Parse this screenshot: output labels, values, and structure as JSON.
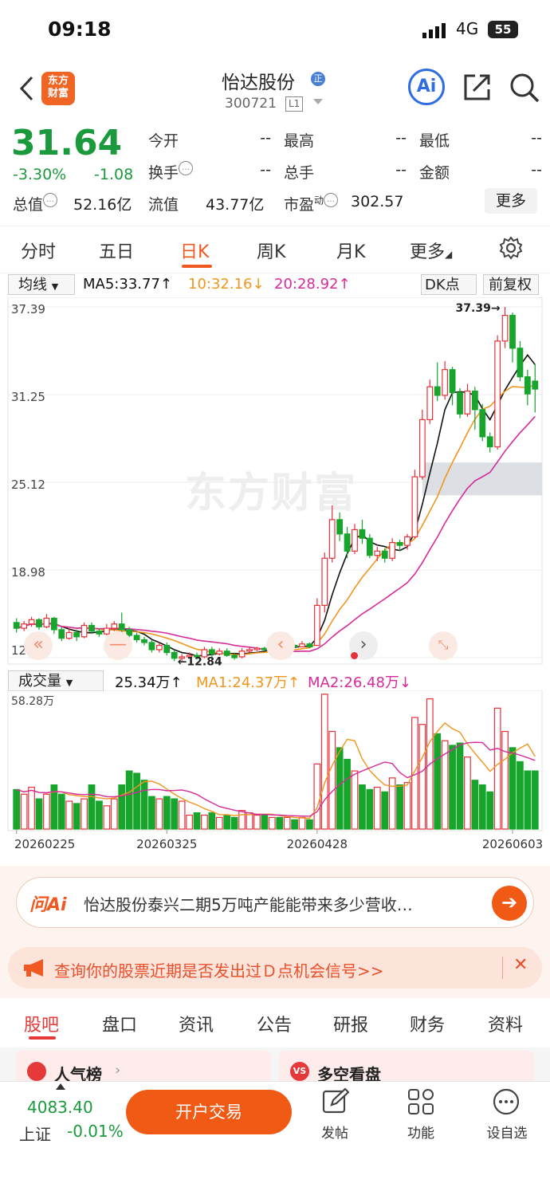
{
  "status_bar": {
    "time": "09:18",
    "network": "4G",
    "battery": "55"
  },
  "header": {
    "logo_line1": "东方",
    "logo_line2": "财富",
    "stock_name": "怡达股份",
    "badge": "正",
    "stock_code": "300721",
    "level": "L1",
    "ai_label": "Ai"
  },
  "quote": {
    "price": "31.64",
    "change_pct": "-3.30%",
    "change": "-1.08",
    "fields": [
      {
        "label": "今开",
        "value": "--"
      },
      {
        "label": "最高",
        "value": "--"
      },
      {
        "label": "最低",
        "value": "--"
      },
      {
        "label": "换手",
        "value": "--"
      },
      {
        "label": "总手",
        "value": "--"
      },
      {
        "label": "金额",
        "value": "--"
      }
    ],
    "total_mv_label": "总值",
    "total_mv": "52.16亿",
    "float_mv_label": "流值",
    "float_mv": "43.77亿",
    "pe_label": "市盈",
    "pe_sup": "动",
    "pe": "302.57",
    "more": "更多"
  },
  "tabs": [
    "分时",
    "五日",
    "日K",
    "周K",
    "月K",
    "更多"
  ],
  "active_tab": "日K",
  "chart_bar": {
    "selector": "均线",
    "ma5": "MA5:33.77↑",
    "ma10": "10:32.16↓",
    "ma20": "20:28.92↑",
    "dk": "DK点",
    "fq": "前复权"
  },
  "watermark": "东方财富",
  "colors": {
    "up": "#e8303a",
    "down": "#17a52c",
    "ma5": "#111111",
    "ma10": "#f0961e",
    "ma20": "#d62b9a",
    "accent": "#f05a22"
  },
  "chart_data": [
    {
      "type": "candlestick",
      "y_ticks": [
        "37.39",
        "31.25",
        "25.12",
        "18.98",
        "12.84"
      ],
      "ylim": [
        12.84,
        37.39
      ],
      "max_label": "37.39→",
      "min_label": "←12.84",
      "candles": [
        [
          15.3,
          14.9,
          15.6,
          14.6
        ],
        [
          14.9,
          15.2,
          15.4,
          14.7
        ],
        [
          15.2,
          15.5,
          15.7,
          15.0
        ],
        [
          15.5,
          15.0,
          15.6,
          14.8
        ],
        [
          15.0,
          15.6,
          15.9,
          14.9
        ],
        [
          15.6,
          14.8,
          15.7,
          14.5
        ],
        [
          14.8,
          14.2,
          15.0,
          14.0
        ],
        [
          14.2,
          14.6,
          14.9,
          14.1
        ],
        [
          14.6,
          14.3,
          14.8,
          14.0
        ],
        [
          14.3,
          15.1,
          15.3,
          14.2
        ],
        [
          15.1,
          14.7,
          15.3,
          14.5
        ],
        [
          14.7,
          14.5,
          14.9,
          14.3
        ],
        [
          14.5,
          14.9,
          15.2,
          14.4
        ],
        [
          14.9,
          15.2,
          15.4,
          14.7
        ],
        [
          15.2,
          14.8,
          16.0,
          14.6
        ],
        [
          14.8,
          14.4,
          15.0,
          14.2
        ],
        [
          14.4,
          14.1,
          14.6,
          13.9
        ],
        [
          14.1,
          13.9,
          14.3,
          13.7
        ],
        [
          13.9,
          13.4,
          14.1,
          13.2
        ],
        [
          13.4,
          13.7,
          13.9,
          13.2
        ],
        [
          13.7,
          13.2,
          13.9,
          13.0
        ],
        [
          13.2,
          12.8,
          13.4,
          12.6
        ],
        [
          12.8,
          12.9,
          13.1,
          12.6
        ],
        [
          12.9,
          13.0,
          13.2,
          12.8
        ],
        [
          13.0,
          12.9,
          13.2,
          12.7
        ],
        [
          12.9,
          13.4,
          13.6,
          12.8
        ],
        [
          13.4,
          13.1,
          13.6,
          12.9
        ],
        [
          13.1,
          13.3,
          13.5,
          13.0
        ],
        [
          13.3,
          13.0,
          13.5,
          12.9
        ],
        [
          13.0,
          12.84,
          13.2,
          12.7
        ],
        [
          12.9,
          13.3,
          13.5,
          12.8
        ],
        [
          13.3,
          13.4,
          13.6,
          13.2
        ],
        [
          13.4,
          13.5,
          13.6,
          13.3
        ],
        [
          13.5,
          13.4,
          13.6,
          13.3
        ],
        [
          13.4,
          13.6,
          13.7,
          13.3
        ],
        [
          13.6,
          13.5,
          13.8,
          13.4
        ],
        [
          13.5,
          13.7,
          13.9,
          13.5
        ],
        [
          13.7,
          13.6,
          13.8,
          13.5
        ],
        [
          13.6,
          13.8,
          14.0,
          13.6
        ],
        [
          13.8,
          13.6,
          13.9,
          13.5
        ],
        [
          13.7,
          16.5,
          17.0,
          13.7
        ],
        [
          16.5,
          19.8,
          20.2,
          16.0
        ],
        [
          19.8,
          22.5,
          23.5,
          19.5
        ],
        [
          22.5,
          21.5,
          23.0,
          21.0
        ],
        [
          21.5,
          20.3,
          22.0,
          19.8
        ],
        [
          20.3,
          21.8,
          22.2,
          20.1
        ],
        [
          21.8,
          21.2,
          22.5,
          20.8
        ],
        [
          21.2,
          20.0,
          21.5,
          19.8
        ],
        [
          20.0,
          20.3,
          20.6,
          19.6
        ],
        [
          20.3,
          19.8,
          20.5,
          19.5
        ],
        [
          19.8,
          20.9,
          21.2,
          19.6
        ],
        [
          20.9,
          20.7,
          21.1,
          20.3
        ],
        [
          20.7,
          21.3,
          21.5,
          20.4
        ],
        [
          21.3,
          25.5,
          26.0,
          21.2
        ],
        [
          25.5,
          29.5,
          30.2,
          25.3
        ],
        [
          29.5,
          31.8,
          32.3,
          29.2
        ],
        [
          31.8,
          31.2,
          33.5,
          30.8
        ],
        [
          31.2,
          33.0,
          33.6,
          30.9
        ],
        [
          33.0,
          31.4,
          33.2,
          30.5
        ],
        [
          31.4,
          29.9,
          31.7,
          29.6
        ],
        [
          29.9,
          31.5,
          32.0,
          29.7
        ],
        [
          31.5,
          30.2,
          31.8,
          28.8
        ],
        [
          30.2,
          28.3,
          30.6,
          28.0
        ],
        [
          28.3,
          27.6,
          28.6,
          27.2
        ],
        [
          27.6,
          35.0,
          35.4,
          27.4
        ],
        [
          35.0,
          36.8,
          37.39,
          34.5
        ],
        [
          36.8,
          34.5,
          37.0,
          33.5
        ],
        [
          34.5,
          32.5,
          35.0,
          32.2
        ],
        [
          32.5,
          31.3,
          33.0,
          30.5
        ],
        [
          32.2,
          31.64,
          33.4,
          30.0
        ]
      ]
    },
    {
      "type": "bar",
      "label": "成交量",
      "value": "25.34万↑",
      "ma1": "MA1:24.37万↑",
      "ma2": "MA2:26.48万↓",
      "y_max_label": "58.28万",
      "ylim": [
        0,
        58.28
      ],
      "x_ticks": [
        "20260225",
        "20260325",
        "20260428",
        "20260603"
      ],
      "volumes": [
        17,
        15,
        18,
        13,
        15,
        19,
        15,
        12,
        11,
        13,
        19,
        12,
        10,
        13,
        19,
        25,
        24,
        21,
        14,
        13,
        14,
        13,
        12,
        6,
        7,
        6,
        7,
        5,
        6,
        5,
        8,
        7,
        6,
        6,
        5,
        5,
        5,
        4,
        5,
        4,
        28,
        58,
        42,
        35,
        30,
        25,
        19,
        17,
        18,
        16,
        22,
        19,
        20,
        48,
        45,
        56,
        41,
        38,
        36,
        37,
        31,
        21,
        19,
        16,
        52,
        42,
        35,
        29,
        25,
        25
      ]
    }
  ],
  "ai_prompt": {
    "brand": "问Ai",
    "text": "怡达股份泰兴二期5万吨产能能带来多少营收…"
  },
  "alert": {
    "text": "查询你的股票近期是否发出过Ｄ点机会信号>>"
  },
  "bottom_tabs": [
    "股吧",
    "盘口",
    "资讯",
    "公告",
    "研报",
    "财务",
    "资料"
  ],
  "active_bottom_tab": "股吧",
  "cards": [
    {
      "label": "人气榜"
    },
    {
      "label": "多空看盘"
    }
  ],
  "index": {
    "value": "4083.40",
    "name": "上证",
    "change": "-0.01%"
  },
  "bottom_nav": {
    "trade": "开户交易",
    "post": "发帖",
    "function": "功能",
    "watchlist": "设自选"
  }
}
